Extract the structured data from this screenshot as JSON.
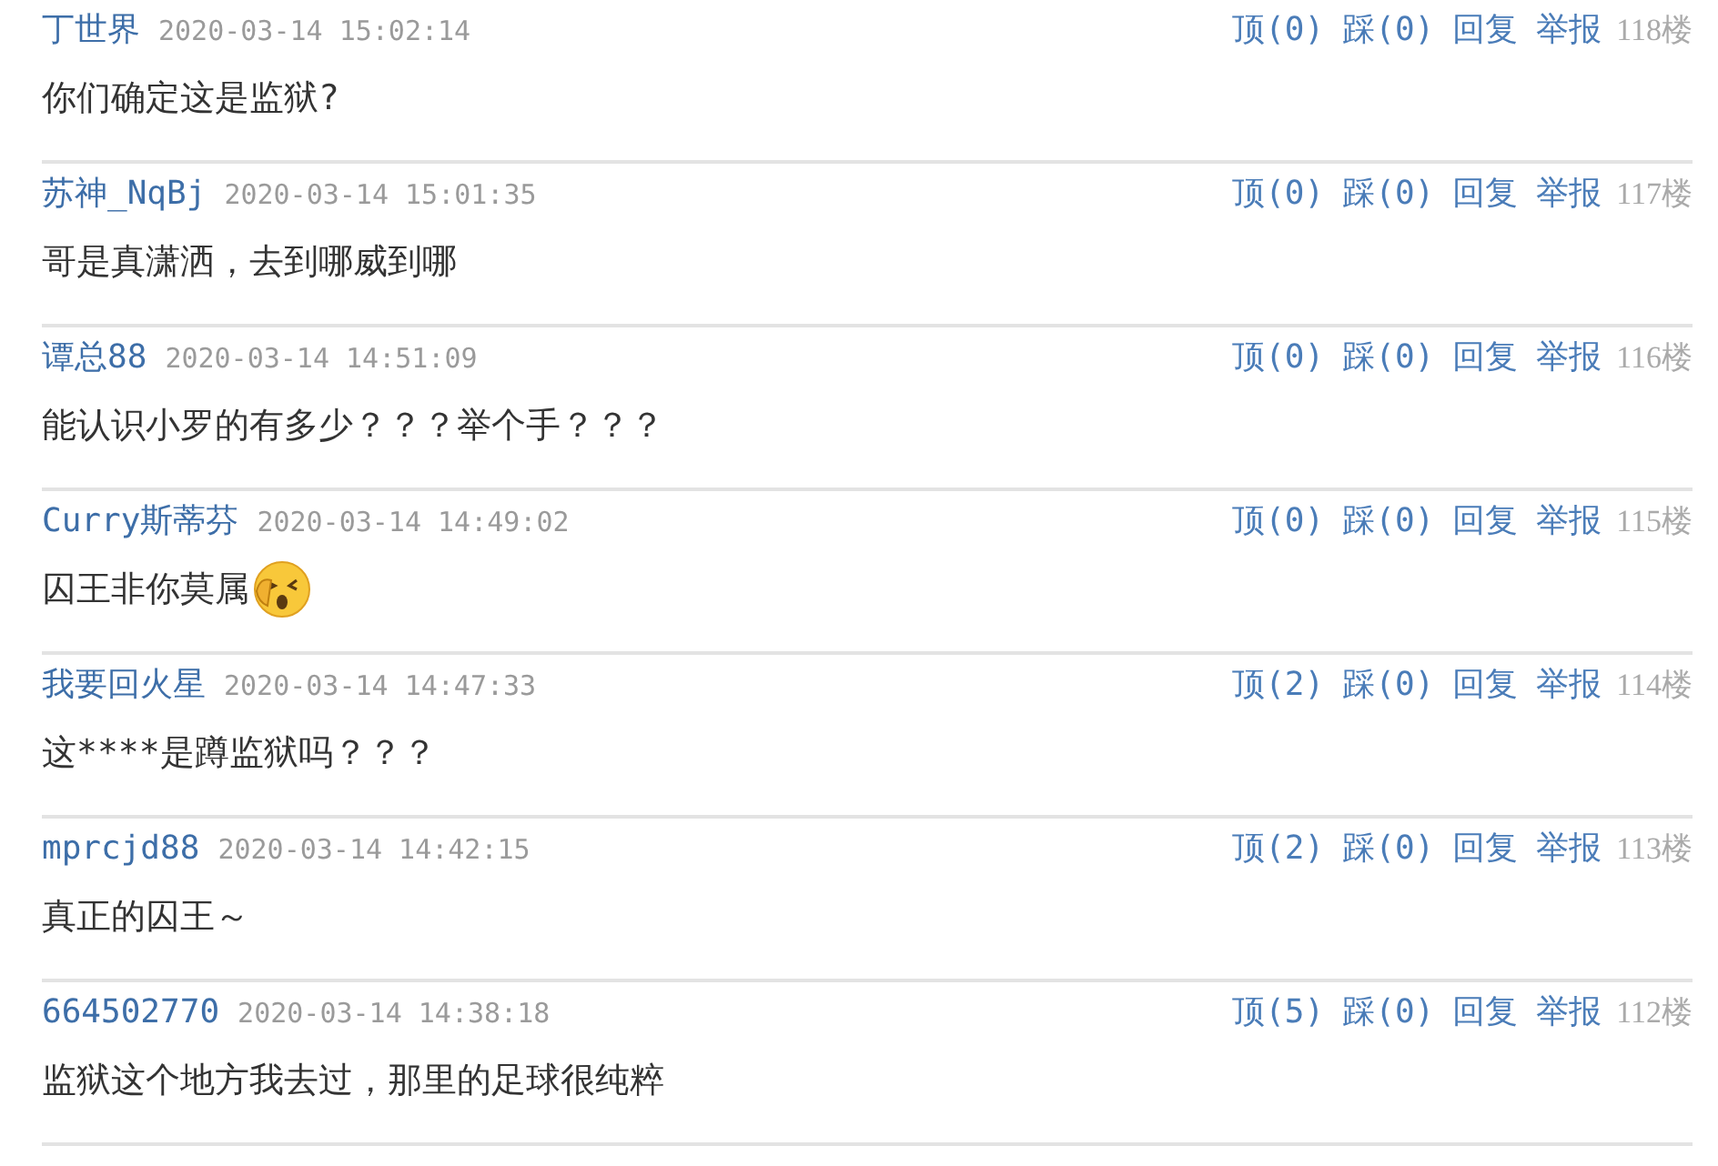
{
  "comments": [
    {
      "user": "丁世界",
      "time": "2020-03-14 15:02:14",
      "up": "顶(0)",
      "down": "踩(0)",
      "reply": "回复",
      "report": "举报",
      "floor": "118楼",
      "text": "你们确定这是监狱?",
      "sticker": false
    },
    {
      "user": "苏神_NqBj",
      "time": "2020-03-14 15:01:35",
      "up": "顶(0)",
      "down": "踩(0)",
      "reply": "回复",
      "report": "举报",
      "floor": "117楼",
      "text": "哥是真潇洒，去到哪威到哪",
      "sticker": false
    },
    {
      "user": "谭总88",
      "time": "2020-03-14 14:51:09",
      "up": "顶(0)",
      "down": "踩(0)",
      "reply": "回复",
      "report": "举报",
      "floor": "116楼",
      "text": "能认识小罗的有多少？？？举个手？？？",
      "sticker": false
    },
    {
      "user": "Curry斯蒂芬",
      "time": "2020-03-14 14:49:02",
      "up": "顶(0)",
      "down": "踩(0)",
      "reply": "回复",
      "report": "举报",
      "floor": "115楼",
      "text": "囚王非你莫属",
      "sticker": true
    },
    {
      "user": "我要回火星",
      "time": "2020-03-14 14:47:33",
      "up": "顶(2)",
      "down": "踩(0)",
      "reply": "回复",
      "report": "举报",
      "floor": "114楼",
      "text": "这****是蹲监狱吗？？？",
      "sticker": false
    },
    {
      "user": "mprcjd88",
      "time": "2020-03-14 14:42:15",
      "up": "顶(2)",
      "down": "踩(0)",
      "reply": "回复",
      "report": "举报",
      "floor": "113楼",
      "text": "真正的囚王～",
      "sticker": false
    },
    {
      "user": "664502770",
      "time": "2020-03-14 14:38:18",
      "up": "顶(5)",
      "down": "踩(0)",
      "reply": "回复",
      "report": "举报",
      "floor": "112楼",
      "text": "监狱这个地方我去过，那里的足球很纯粹",
      "sticker": false
    }
  ]
}
